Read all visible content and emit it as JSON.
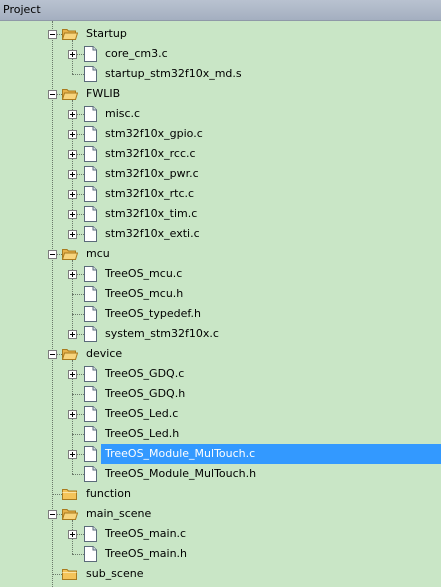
{
  "panel": {
    "title": "Project"
  },
  "tree": [
    {
      "label": "Startup",
      "type": "folder",
      "open": true,
      "exp": "minus"
    },
    {
      "label": "core_cm3.c",
      "type": "file",
      "exp": "plus"
    },
    {
      "label": "startup_stm32f10x_md.s",
      "type": "file",
      "exp": ""
    },
    {
      "label": "FWLIB",
      "type": "folder",
      "open": true,
      "exp": "minus"
    },
    {
      "label": "misc.c",
      "type": "file",
      "exp": "plus"
    },
    {
      "label": "stm32f10x_gpio.c",
      "type": "file",
      "exp": "plus"
    },
    {
      "label": "stm32f10x_rcc.c",
      "type": "file",
      "exp": "plus"
    },
    {
      "label": "stm32f10x_pwr.c",
      "type": "file",
      "exp": "plus"
    },
    {
      "label": "stm32f10x_rtc.c",
      "type": "file",
      "exp": "plus"
    },
    {
      "label": "stm32f10x_tim.c",
      "type": "file",
      "exp": "plus"
    },
    {
      "label": "stm32f10x_exti.c",
      "type": "file",
      "exp": "plus"
    },
    {
      "label": "mcu",
      "type": "folder",
      "open": true,
      "exp": "minus"
    },
    {
      "label": "TreeOS_mcu.c",
      "type": "file",
      "exp": "plus"
    },
    {
      "label": "TreeOS_mcu.h",
      "type": "file",
      "exp": ""
    },
    {
      "label": "TreeOS_typedef.h",
      "type": "file",
      "exp": ""
    },
    {
      "label": "system_stm32f10x.c",
      "type": "file",
      "exp": "plus"
    },
    {
      "label": "device",
      "type": "folder",
      "open": true,
      "exp": "minus"
    },
    {
      "label": "TreeOS_GDQ.c",
      "type": "file",
      "exp": "plus"
    },
    {
      "label": "TreeOS_GDQ.h",
      "type": "file",
      "exp": ""
    },
    {
      "label": "TreeOS_Led.c",
      "type": "file",
      "exp": "plus"
    },
    {
      "label": "TreeOS_Led.h",
      "type": "file",
      "exp": ""
    },
    {
      "label": "TreeOS_Module_MulTouch.c",
      "type": "file",
      "exp": "plus",
      "selected": true
    },
    {
      "label": "TreeOS_Module_MulTouch.h",
      "type": "file",
      "exp": ""
    },
    {
      "label": "function",
      "type": "folder",
      "open": false,
      "exp": ""
    },
    {
      "label": "main_scene",
      "type": "folder",
      "open": true,
      "exp": "minus"
    },
    {
      "label": "TreeOS_main.c",
      "type": "file",
      "exp": "plus"
    },
    {
      "label": "TreeOS_main.h",
      "type": "file",
      "exp": ""
    },
    {
      "label": "sub_scene",
      "type": "folder",
      "open": false,
      "exp": ""
    }
  ],
  "colors": {
    "background": "#c9e6c6",
    "selection": "#3399ff",
    "folder": "#f4c45a"
  }
}
